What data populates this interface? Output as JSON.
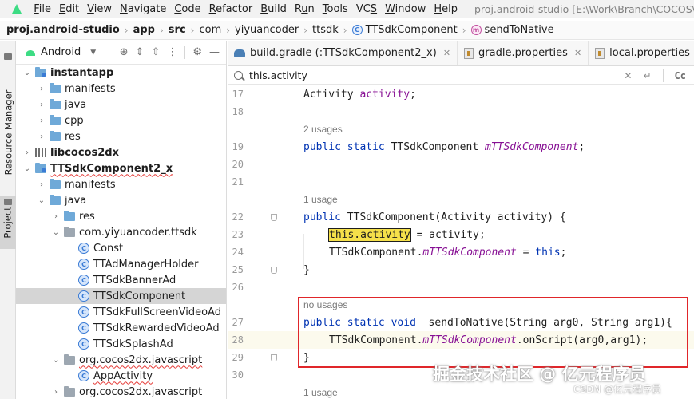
{
  "menu": {
    "items": [
      {
        "label": "File",
        "key": "F"
      },
      {
        "label": "Edit",
        "key": "E"
      },
      {
        "label": "View",
        "key": "V"
      },
      {
        "label": "Navigate",
        "key": "N"
      },
      {
        "label": "Code",
        "key": "C"
      },
      {
        "label": "Refactor",
        "key": "R"
      },
      {
        "label": "Build",
        "key": "B"
      },
      {
        "label": "Run",
        "key": "u"
      },
      {
        "label": "Tools",
        "key": "T"
      },
      {
        "label": "VCS",
        "key": "S"
      },
      {
        "label": "Window",
        "key": "W"
      },
      {
        "label": "Help",
        "key": "H"
      }
    ],
    "window_title": "proj.android-studio [E:\\Work\\Branch\\COCOS\\TT"
  },
  "breadcrumb": {
    "items": [
      "proj.android-studio",
      "app",
      "src",
      "com",
      "yiyuancoder",
      "ttsdk",
      "TTSdkComponent",
      "sendToNative"
    ],
    "separator": "›"
  },
  "toolstrip": {
    "resource_manager": "Resource Manager",
    "project": "Project"
  },
  "project_panel": {
    "title": "Android",
    "tree": [
      {
        "label": "instantapp",
        "depth": 0,
        "arrow": "down",
        "icon": "module-folder",
        "bold": true
      },
      {
        "label": "manifests",
        "depth": 1,
        "arrow": "right",
        "icon": "folder"
      },
      {
        "label": "java",
        "depth": 1,
        "arrow": "right",
        "icon": "folder"
      },
      {
        "label": "cpp",
        "depth": 1,
        "arrow": "right",
        "icon": "folder"
      },
      {
        "label": "res",
        "depth": 1,
        "arrow": "right",
        "icon": "folder"
      },
      {
        "label": "libcocos2dx",
        "depth": 0,
        "arrow": "right",
        "icon": "library",
        "bold": true
      },
      {
        "label": "TTSdkComponent2_x",
        "depth": 0,
        "arrow": "down",
        "icon": "module-folder",
        "bold": true,
        "squiggle": true
      },
      {
        "label": "manifests",
        "depth": 1,
        "arrow": "right",
        "icon": "folder"
      },
      {
        "label": "java",
        "depth": 1,
        "arrow": "down",
        "icon": "folder"
      },
      {
        "label": "res",
        "depth": 2,
        "arrow": "right",
        "icon": "folder"
      },
      {
        "label": "com.yiyuancoder.ttsdk",
        "depth": 2,
        "arrow": "down",
        "icon": "package"
      },
      {
        "label": "Const",
        "depth": 3,
        "arrow": "none",
        "icon": "class"
      },
      {
        "label": "TTAdManagerHolder",
        "depth": 3,
        "arrow": "none",
        "icon": "class"
      },
      {
        "label": "TTSdkBannerAd",
        "depth": 3,
        "arrow": "none",
        "icon": "class"
      },
      {
        "label": "TTSdkComponent",
        "depth": 3,
        "arrow": "none",
        "icon": "class",
        "selected": true
      },
      {
        "label": "TTSdkFullScreenVideoAd",
        "depth": 3,
        "arrow": "none",
        "icon": "class"
      },
      {
        "label": "TTSdkRewardedVideoAd",
        "depth": 3,
        "arrow": "none",
        "icon": "class"
      },
      {
        "label": "TTSdkSplashAd",
        "depth": 3,
        "arrow": "none",
        "icon": "class"
      },
      {
        "label": "org.cocos2dx.javascript",
        "depth": 2,
        "arrow": "down",
        "icon": "package",
        "squiggle": true
      },
      {
        "label": "AppActivity",
        "depth": 3,
        "arrow": "none",
        "icon": "class",
        "squiggle": true
      },
      {
        "label": "org.cocos2dx.javascript",
        "depth": 2,
        "arrow": "right",
        "icon": "package"
      }
    ]
  },
  "tabs": [
    {
      "label": "build.gradle (:TTSdkComponent2_x)",
      "icon": "gradle"
    },
    {
      "label": "gradle.properties",
      "icon": "props"
    },
    {
      "label": "local.properties",
      "icon": "props"
    },
    {
      "label": "",
      "icon": "class"
    }
  ],
  "search": {
    "value": "this.activity",
    "case_label": "Cc"
  },
  "editor": {
    "lines": [
      {
        "kind": "code",
        "num": "17",
        "indent": 1,
        "tokens": [
          {
            "t": "Activity "
          },
          {
            "t": "activity",
            "c": "fld"
          },
          {
            "t": ";"
          }
        ]
      },
      {
        "kind": "code",
        "num": "18",
        "indent": 0,
        "tokens": []
      },
      {
        "kind": "hint",
        "text": "2 usages"
      },
      {
        "kind": "code",
        "num": "19",
        "indent": 1,
        "tokens": [
          {
            "t": "public ",
            "c": "kw"
          },
          {
            "t": "static ",
            "c": "kw"
          },
          {
            "t": "TTSdkComponent "
          },
          {
            "t": "mTTSdkComponent",
            "c": "fld-i"
          },
          {
            "t": ";"
          }
        ]
      },
      {
        "kind": "code",
        "num": "20",
        "indent": 0,
        "tokens": []
      },
      {
        "kind": "code",
        "num": "21",
        "indent": 0,
        "tokens": []
      },
      {
        "kind": "hint",
        "text": "1 usage"
      },
      {
        "kind": "code",
        "num": "22",
        "indent": 1,
        "fold": true,
        "tokens": [
          {
            "t": "public ",
            "c": "kw"
          },
          {
            "t": "TTSdkComponent(Activity activity) {"
          }
        ]
      },
      {
        "kind": "code",
        "num": "23",
        "indent": 2,
        "tokens": [
          {
            "t": "this.activity",
            "c": "match"
          },
          {
            "t": " = activity;"
          }
        ]
      },
      {
        "kind": "code",
        "num": "24",
        "indent": 2,
        "tokens": [
          {
            "t": "TTSdkComponent."
          },
          {
            "t": "mTTSdkComponent",
            "c": "fld-i"
          },
          {
            "t": " = "
          },
          {
            "t": "this",
            "c": "kw"
          },
          {
            "t": ";"
          }
        ]
      },
      {
        "kind": "code",
        "num": "25",
        "indent": 1,
        "fold": true,
        "tokens": [
          {
            "t": "}"
          }
        ]
      },
      {
        "kind": "code",
        "num": "26",
        "indent": 0,
        "tokens": []
      },
      {
        "kind": "hint",
        "text": "no usages"
      },
      {
        "kind": "code",
        "num": "27",
        "indent": 1,
        "tokens": [
          {
            "t": "public ",
            "c": "kw"
          },
          {
            "t": "static ",
            "c": "kw"
          },
          {
            "t": "void ",
            "c": "kw"
          },
          {
            "t": " sendToNative(String arg0, String arg1){"
          }
        ]
      },
      {
        "kind": "code",
        "num": "28",
        "indent": 2,
        "hl": true,
        "tokens": [
          {
            "t": "TTSdkComponent."
          },
          {
            "t": "mTTSdkComponent",
            "c": "fld-i"
          },
          {
            "t": ".onScript(arg0,arg1);"
          }
        ]
      },
      {
        "kind": "code",
        "num": "29",
        "indent": 1,
        "fold": true,
        "tokens": [
          {
            "t": "}"
          }
        ]
      },
      {
        "kind": "code",
        "num": "30",
        "indent": 0,
        "tokens": []
      },
      {
        "kind": "hint",
        "text": "1 usage"
      }
    ]
  },
  "watermark": {
    "main": "掘金技术社区 @ 亿元程序员",
    "small": "CSDN @亿元程序员"
  },
  "colors": {
    "keyword": "#0033b3",
    "field": "#871094",
    "search_match": "#f5e04a",
    "annotation_box": "#e0262a",
    "selected_row": "#d5d5d5"
  }
}
